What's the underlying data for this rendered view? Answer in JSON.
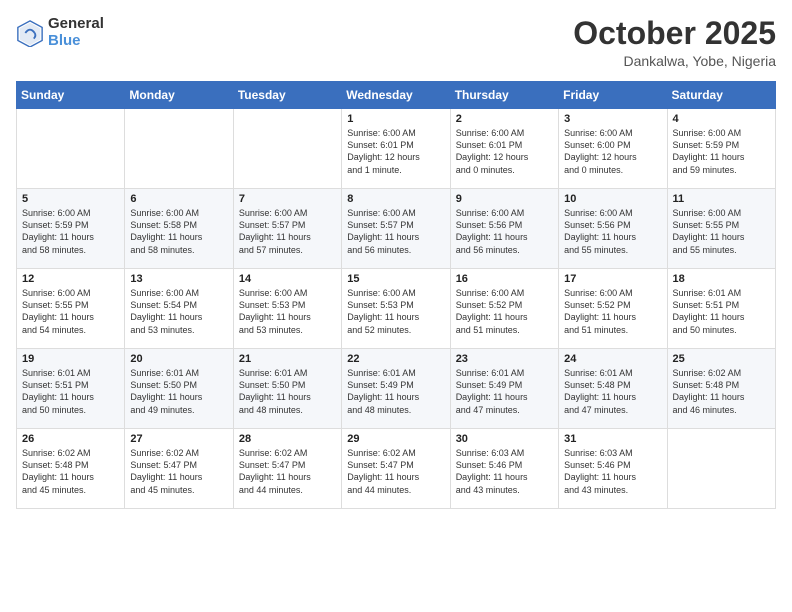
{
  "header": {
    "logo_general": "General",
    "logo_blue": "Blue",
    "month_title": "October 2025",
    "location": "Dankalwa, Yobe, Nigeria"
  },
  "days_of_week": [
    "Sunday",
    "Monday",
    "Tuesday",
    "Wednesday",
    "Thursday",
    "Friday",
    "Saturday"
  ],
  "weeks": [
    [
      {
        "day": "",
        "text": ""
      },
      {
        "day": "",
        "text": ""
      },
      {
        "day": "",
        "text": ""
      },
      {
        "day": "1",
        "text": "Sunrise: 6:00 AM\nSunset: 6:01 PM\nDaylight: 12 hours\nand 1 minute."
      },
      {
        "day": "2",
        "text": "Sunrise: 6:00 AM\nSunset: 6:01 PM\nDaylight: 12 hours\nand 0 minutes."
      },
      {
        "day": "3",
        "text": "Sunrise: 6:00 AM\nSunset: 6:00 PM\nDaylight: 12 hours\nand 0 minutes."
      },
      {
        "day": "4",
        "text": "Sunrise: 6:00 AM\nSunset: 5:59 PM\nDaylight: 11 hours\nand 59 minutes."
      }
    ],
    [
      {
        "day": "5",
        "text": "Sunrise: 6:00 AM\nSunset: 5:59 PM\nDaylight: 11 hours\nand 58 minutes."
      },
      {
        "day": "6",
        "text": "Sunrise: 6:00 AM\nSunset: 5:58 PM\nDaylight: 11 hours\nand 58 minutes."
      },
      {
        "day": "7",
        "text": "Sunrise: 6:00 AM\nSunset: 5:57 PM\nDaylight: 11 hours\nand 57 minutes."
      },
      {
        "day": "8",
        "text": "Sunrise: 6:00 AM\nSunset: 5:57 PM\nDaylight: 11 hours\nand 56 minutes."
      },
      {
        "day": "9",
        "text": "Sunrise: 6:00 AM\nSunset: 5:56 PM\nDaylight: 11 hours\nand 56 minutes."
      },
      {
        "day": "10",
        "text": "Sunrise: 6:00 AM\nSunset: 5:56 PM\nDaylight: 11 hours\nand 55 minutes."
      },
      {
        "day": "11",
        "text": "Sunrise: 6:00 AM\nSunset: 5:55 PM\nDaylight: 11 hours\nand 55 minutes."
      }
    ],
    [
      {
        "day": "12",
        "text": "Sunrise: 6:00 AM\nSunset: 5:55 PM\nDaylight: 11 hours\nand 54 minutes."
      },
      {
        "day": "13",
        "text": "Sunrise: 6:00 AM\nSunset: 5:54 PM\nDaylight: 11 hours\nand 53 minutes."
      },
      {
        "day": "14",
        "text": "Sunrise: 6:00 AM\nSunset: 5:53 PM\nDaylight: 11 hours\nand 53 minutes."
      },
      {
        "day": "15",
        "text": "Sunrise: 6:00 AM\nSunset: 5:53 PM\nDaylight: 11 hours\nand 52 minutes."
      },
      {
        "day": "16",
        "text": "Sunrise: 6:00 AM\nSunset: 5:52 PM\nDaylight: 11 hours\nand 51 minutes."
      },
      {
        "day": "17",
        "text": "Sunrise: 6:00 AM\nSunset: 5:52 PM\nDaylight: 11 hours\nand 51 minutes."
      },
      {
        "day": "18",
        "text": "Sunrise: 6:01 AM\nSunset: 5:51 PM\nDaylight: 11 hours\nand 50 minutes."
      }
    ],
    [
      {
        "day": "19",
        "text": "Sunrise: 6:01 AM\nSunset: 5:51 PM\nDaylight: 11 hours\nand 50 minutes."
      },
      {
        "day": "20",
        "text": "Sunrise: 6:01 AM\nSunset: 5:50 PM\nDaylight: 11 hours\nand 49 minutes."
      },
      {
        "day": "21",
        "text": "Sunrise: 6:01 AM\nSunset: 5:50 PM\nDaylight: 11 hours\nand 48 minutes."
      },
      {
        "day": "22",
        "text": "Sunrise: 6:01 AM\nSunset: 5:49 PM\nDaylight: 11 hours\nand 48 minutes."
      },
      {
        "day": "23",
        "text": "Sunrise: 6:01 AM\nSunset: 5:49 PM\nDaylight: 11 hours\nand 47 minutes."
      },
      {
        "day": "24",
        "text": "Sunrise: 6:01 AM\nSunset: 5:48 PM\nDaylight: 11 hours\nand 47 minutes."
      },
      {
        "day": "25",
        "text": "Sunrise: 6:02 AM\nSunset: 5:48 PM\nDaylight: 11 hours\nand 46 minutes."
      }
    ],
    [
      {
        "day": "26",
        "text": "Sunrise: 6:02 AM\nSunset: 5:48 PM\nDaylight: 11 hours\nand 45 minutes."
      },
      {
        "day": "27",
        "text": "Sunrise: 6:02 AM\nSunset: 5:47 PM\nDaylight: 11 hours\nand 45 minutes."
      },
      {
        "day": "28",
        "text": "Sunrise: 6:02 AM\nSunset: 5:47 PM\nDaylight: 11 hours\nand 44 minutes."
      },
      {
        "day": "29",
        "text": "Sunrise: 6:02 AM\nSunset: 5:47 PM\nDaylight: 11 hours\nand 44 minutes."
      },
      {
        "day": "30",
        "text": "Sunrise: 6:03 AM\nSunset: 5:46 PM\nDaylight: 11 hours\nand 43 minutes."
      },
      {
        "day": "31",
        "text": "Sunrise: 6:03 AM\nSunset: 5:46 PM\nDaylight: 11 hours\nand 43 minutes."
      },
      {
        "day": "",
        "text": ""
      }
    ]
  ]
}
